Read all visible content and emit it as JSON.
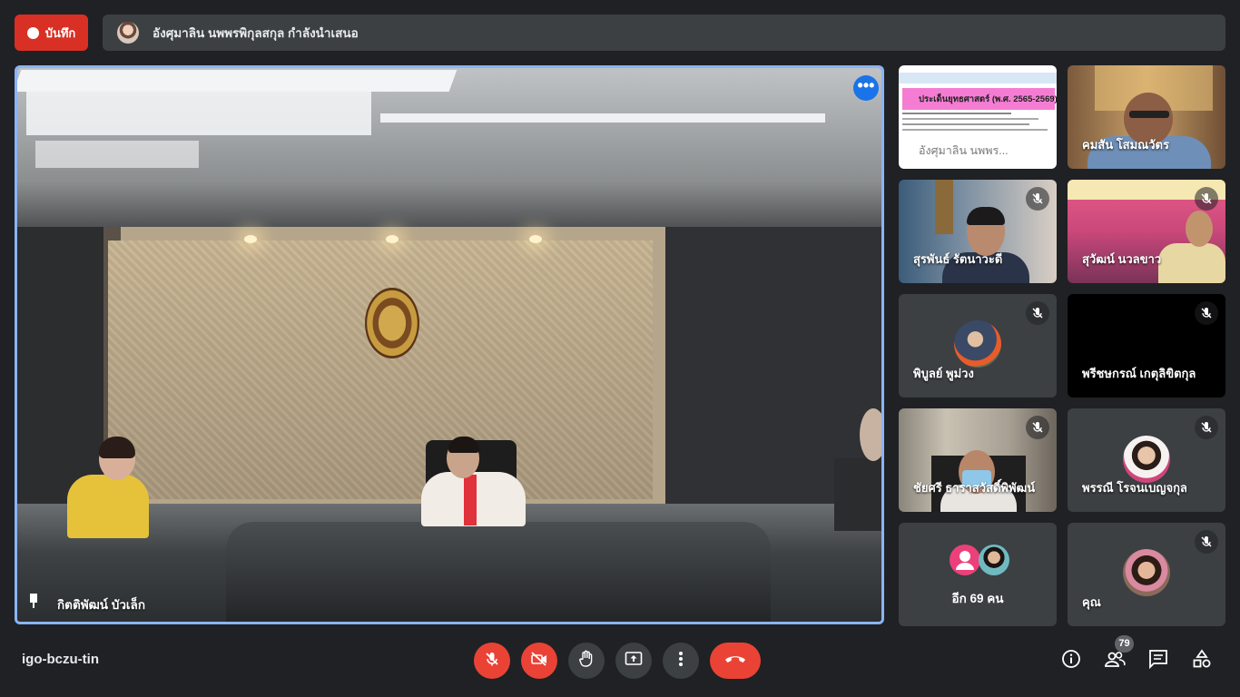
{
  "topbar": {
    "record_label": "บันทึก",
    "presenting_text": "อังศุมาลิน นพพรพิกุลสกุล กำลังนำเสนอ"
  },
  "main_video": {
    "participant_name": "กิตติพัฒน์ บัวเล็ก"
  },
  "tiles": [
    {
      "name": "",
      "type": "presentation",
      "slide_title": "ประเด็นยุทธศาสตร์ (พ.ศ. 2565-2569)",
      "slide_caption": "อังศุมาลิน นพพร..."
    },
    {
      "name": "คมสัน โสมณวัตร",
      "muted": false
    },
    {
      "name": "สุรพันธ์ รัตนาวะดี",
      "muted": true
    },
    {
      "name": "สุวัฒน์ นวลขาว",
      "muted": true
    },
    {
      "name": "พิบูลย์ พูม่วง",
      "muted": true
    },
    {
      "name": "พรีชษกรณ์ เกตุลิขิตกุล",
      "muted": true
    },
    {
      "name": "ชัยศรี ธาราสวัสดิ์พิพัฒน์",
      "muted": true
    },
    {
      "name": "พรรณี โรจนเบญจกุล",
      "muted": true
    },
    {
      "name": "อีก 69 คน",
      "muted": false
    },
    {
      "name": "คุณ",
      "muted": true
    }
  ],
  "bottombar": {
    "meeting_code": "igo-bczu-tin",
    "participant_count": "79"
  },
  "colors": {
    "background": "#202124",
    "tile": "#3c4043",
    "accent_blue": "#8ab4f8",
    "danger_red": "#ea4335"
  }
}
